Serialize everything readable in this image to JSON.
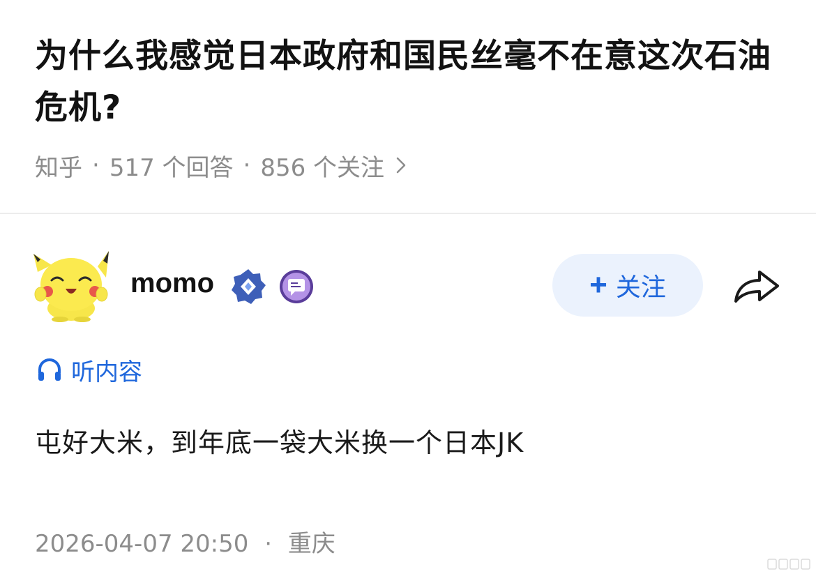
{
  "question": {
    "title": "为什么我感觉日本政府和国民丝毫不在意这次石油危机?"
  },
  "meta": {
    "source": "知乎",
    "answers": "517 个回答",
    "followers": "856 个关注",
    "separator": "·"
  },
  "author": {
    "name": "momo",
    "follow_plus": "+",
    "follow_label": "关注"
  },
  "listen": {
    "label": "听内容"
  },
  "answer": {
    "text": "屯好大米，到年底一袋大米换一个日本JK"
  },
  "footer": {
    "datetime": "2026-04-07 20:50",
    "separator": "·",
    "location": "重庆"
  },
  "icons": {
    "chevron": "chevron-right-icon",
    "verified": "verified-badge-icon",
    "creator": "creator-badge-icon",
    "share": "share-icon",
    "headphone": "headphone-icon"
  },
  "colors": {
    "accent": "#1f67dc",
    "follow_bg": "#ebf2fd",
    "meta_gray": "#8c8c8c"
  }
}
